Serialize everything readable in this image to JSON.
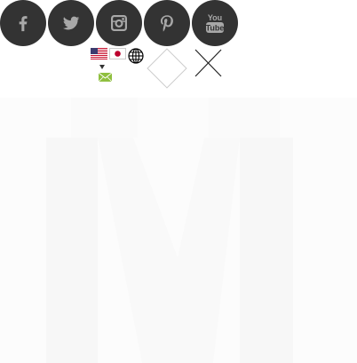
{
  "social": {
    "items": [
      {
        "name": "facebook",
        "icon": "facebook-icon"
      },
      {
        "name": "twitter",
        "icon": "twitter-icon"
      },
      {
        "name": "instagram",
        "icon": "instagram-icon"
      },
      {
        "name": "pinterest",
        "icon": "pinterest-icon"
      },
      {
        "name": "youtube",
        "icon": "youtube-icon",
        "logo_text_top": "You",
        "logo_text_bottom": "Tube"
      }
    ],
    "button_color": "#333333",
    "icon_color": "#a8a8a8"
  },
  "language": {
    "flags": [
      {
        "icon": "us-flag-icon"
      },
      {
        "icon": "japan-flag-icon"
      }
    ],
    "globe_icon": "globe-icon",
    "dropdown_icon": "dropdown-arrow-icon",
    "mail_icon": "mail-icon",
    "mail_color": "#8fbf3f"
  },
  "actions": {
    "diamond_icon": "diamond-icon",
    "close_icon": "close-icon"
  },
  "hero": {
    "background": "#fcfcfc"
  }
}
